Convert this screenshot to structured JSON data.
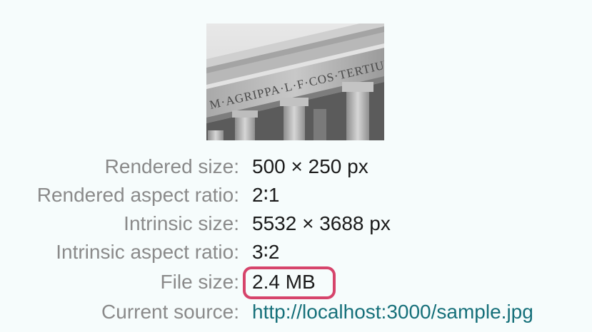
{
  "image": {
    "inscription": "M·AGRIPPA·L·F·COS·TERTIUM"
  },
  "rows": [
    {
      "label": "Rendered size:",
      "value": "500 × 250 px"
    },
    {
      "label": "Rendered aspect ratio:",
      "value": "2∶1"
    },
    {
      "label": "Intrinsic size:",
      "value": "5532 × 3688 px"
    },
    {
      "label": "Intrinsic aspect ratio:",
      "value": "3∶2"
    },
    {
      "label": "File size:",
      "value": "2.4 MB"
    },
    {
      "label": "Current source:",
      "value": "http://localhost:3000/sample.jpg"
    }
  ],
  "colors": {
    "background": "#f6fcfc",
    "label": "#8a8a8a",
    "value": "#1a1a1a",
    "link": "#16707a",
    "highlight": "#d6446b"
  }
}
